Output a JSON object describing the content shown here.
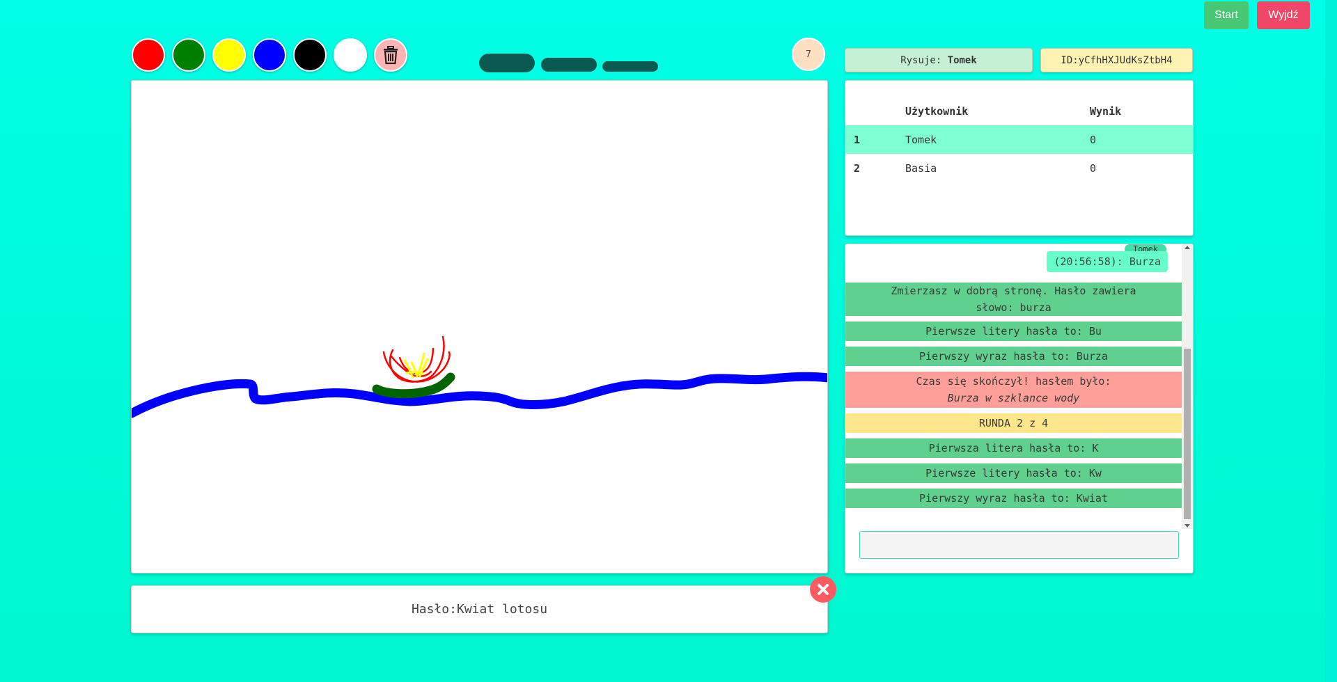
{
  "header": {
    "start_label": "Start",
    "exit_label": "Wyjdź"
  },
  "palette": {
    "colors": [
      {
        "name": "red",
        "hex": "#ff0000"
      },
      {
        "name": "green",
        "hex": "#008000"
      },
      {
        "name": "yellow",
        "hex": "#ffff00"
      },
      {
        "name": "blue",
        "hex": "#0000ff"
      },
      {
        "name": "black",
        "hex": "#000000"
      },
      {
        "name": "white",
        "hex": "#ffffff"
      }
    ],
    "clear_icon": "trash-icon"
  },
  "brush_sizes": [
    "large",
    "medium",
    "small"
  ],
  "timer": {
    "value": "7"
  },
  "drawer": {
    "label": "Rysuje: ",
    "name": "Tomek"
  },
  "room": {
    "id": "ID:yCfhHXJUdKsZtbH4"
  },
  "scoreboard": {
    "headers": [
      "",
      "Użytkownik",
      "Wynik"
    ],
    "rows": [
      {
        "rank": "1",
        "user": "Tomek",
        "score": "0",
        "highlighted": true
      },
      {
        "rank": "2",
        "user": "Basia",
        "score": "0",
        "highlighted": false
      }
    ]
  },
  "chat": {
    "user_message": {
      "author": "Tomek",
      "text": "(20:56:58): Burza"
    },
    "messages": [
      {
        "text": "Zmierzasz w dobrą stronę. Hasło zawiera słowo: burza",
        "kind": "green"
      },
      {
        "text": "Pierwsze litery hasła to: Bu",
        "kind": "green"
      },
      {
        "text": "Pierwszy wyraz hasła to: Burza",
        "kind": "green"
      },
      {
        "text": "Czas się skończył! hasłem było:",
        "extra": "Burza w szklance wody",
        "kind": "red"
      },
      {
        "text": "RUNDA 2 z 4",
        "kind": "yellow"
      },
      {
        "text": "Pierwsza litera hasła to: K",
        "kind": "green"
      },
      {
        "text": "Pierwsze litery hasła to: Kw",
        "kind": "green"
      },
      {
        "text": "Pierwszy wyraz hasła to: Kwiat",
        "kind": "green"
      }
    ],
    "input_value": "",
    "input_placeholder": ""
  },
  "password": {
    "label": "Hasło:",
    "value": "Kwiat lotosu",
    "close_icon": "close-icon"
  },
  "colors": {
    "background_top": "#00ffe6",
    "highlight_row": "#7fffd4",
    "message_green": "#5fd08d",
    "message_red": "#ff9f9a",
    "message_yellow": "#ffe68a",
    "drawer_box": "#c6f0d3",
    "id_box": "#fff3b3",
    "stroke_blue": "#0000ff",
    "stroke_green": "#006400",
    "stroke_red": "#ff0000",
    "stroke_yellow": "#ffff00"
  }
}
